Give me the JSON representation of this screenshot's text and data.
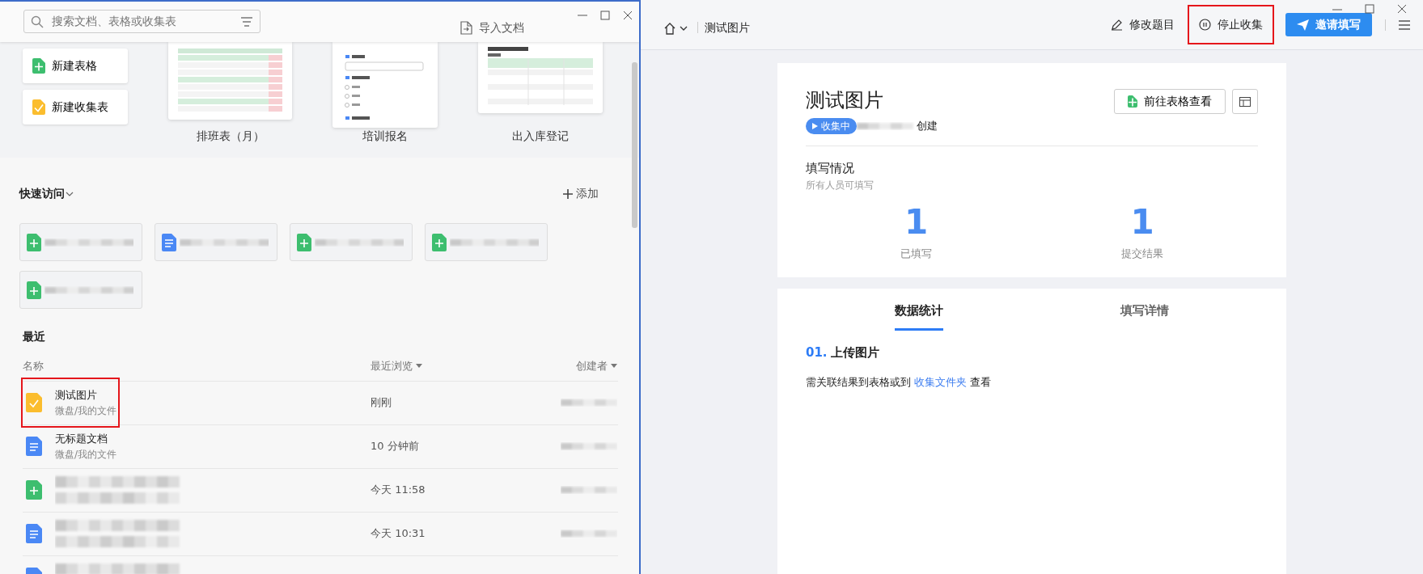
{
  "left_window": {
    "search": {
      "placeholder": "搜索文档、表格或收集表"
    },
    "import_button": "导入文档",
    "new_buttons": [
      {
        "label": "新建表格",
        "kind": "sheet"
      },
      {
        "label": "新建收集表",
        "kind": "form"
      }
    ],
    "templates": [
      {
        "label": "排班表（月）",
        "kind": "schedule"
      },
      {
        "label": "培训报名",
        "kind": "signup"
      },
      {
        "label": "出入库登记",
        "kind": "inventory"
      }
    ],
    "quick_access": {
      "title": "快速访问",
      "add_button": "添加",
      "items": [
        {
          "kind": "sheet"
        },
        {
          "kind": "doc"
        },
        {
          "kind": "sheet"
        },
        {
          "kind": "sheet"
        },
        {
          "kind": "sheet"
        }
      ]
    },
    "recent": {
      "title": "最近",
      "columns": [
        "名称",
        "最近浏览",
        "创建者"
      ],
      "rows": [
        {
          "name": "测试图片",
          "path": "微盘/我的文件",
          "time": "刚刚",
          "kind": "form",
          "highlighted": true
        },
        {
          "name": "无标题文档",
          "path": "微盘/我的文件",
          "time": "10 分钟前",
          "kind": "doc",
          "highlighted": false
        },
        {
          "time": "今天 11:58",
          "kind": "sheet",
          "highlighted": false
        },
        {
          "time": "今天 10:31",
          "kind": "doc",
          "highlighted": false
        },
        {
          "kind": "doc",
          "highlighted": false
        }
      ]
    }
  },
  "right_window": {
    "breadcrumb": "测试图片",
    "actions": [
      {
        "label": "修改题目",
        "kind": "edit",
        "highlighted": false
      },
      {
        "label": "停止收集",
        "kind": "pause",
        "highlighted": true
      }
    ],
    "invite_button": "邀请填写",
    "form": {
      "title": "测试图片",
      "open_sheet_button": "前往表格查看",
      "status": "收集中",
      "created_suffix": "创建",
      "section_title": "填写情况",
      "section_note": "所有人员可填写",
      "stats": [
        {
          "value": "1",
          "label": "已填写"
        },
        {
          "value": "1",
          "label": "提交结果"
        }
      ]
    },
    "tabs": [
      {
        "label": "数据统计",
        "selected": true
      },
      {
        "label": "填写详情",
        "selected": false
      }
    ],
    "question": {
      "number": "01.",
      "title": "上传图片",
      "note_before": "需关联结果到表格或到",
      "link": "收集文件夹",
      "note_after": "查看"
    }
  }
}
